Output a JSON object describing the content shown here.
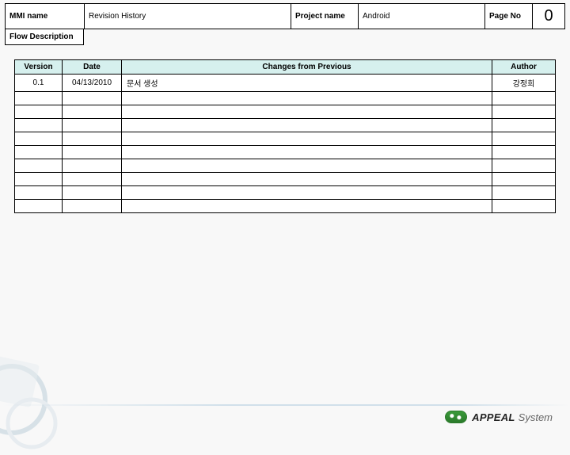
{
  "header": {
    "mmi_label": "MMI name",
    "title": "Revision History",
    "project_label": "Project name",
    "project_value": "Android",
    "page_label": "Page No",
    "page_value": "0"
  },
  "flow_description_label": "Flow Description",
  "rev_table": {
    "columns": {
      "version": "Version",
      "date": "Date",
      "changes": "Changes from Previous",
      "author": "Author"
    },
    "rows": [
      {
        "version": "0.1",
        "date": "04/13/2010",
        "changes": "문서 생성",
        "author": "강정희"
      },
      {
        "version": "",
        "date": "",
        "changes": "",
        "author": ""
      },
      {
        "version": "",
        "date": "",
        "changes": "",
        "author": ""
      },
      {
        "version": "",
        "date": "",
        "changes": "",
        "author": ""
      },
      {
        "version": "",
        "date": "",
        "changes": "",
        "author": ""
      },
      {
        "version": "",
        "date": "",
        "changes": "",
        "author": ""
      },
      {
        "version": "",
        "date": "",
        "changes": "",
        "author": ""
      },
      {
        "version": "",
        "date": "",
        "changes": "",
        "author": ""
      },
      {
        "version": "",
        "date": "",
        "changes": "",
        "author": ""
      },
      {
        "version": "",
        "date": "",
        "changes": "",
        "author": ""
      }
    ]
  },
  "brand": {
    "strong": "APPEAL",
    "light": "System"
  }
}
